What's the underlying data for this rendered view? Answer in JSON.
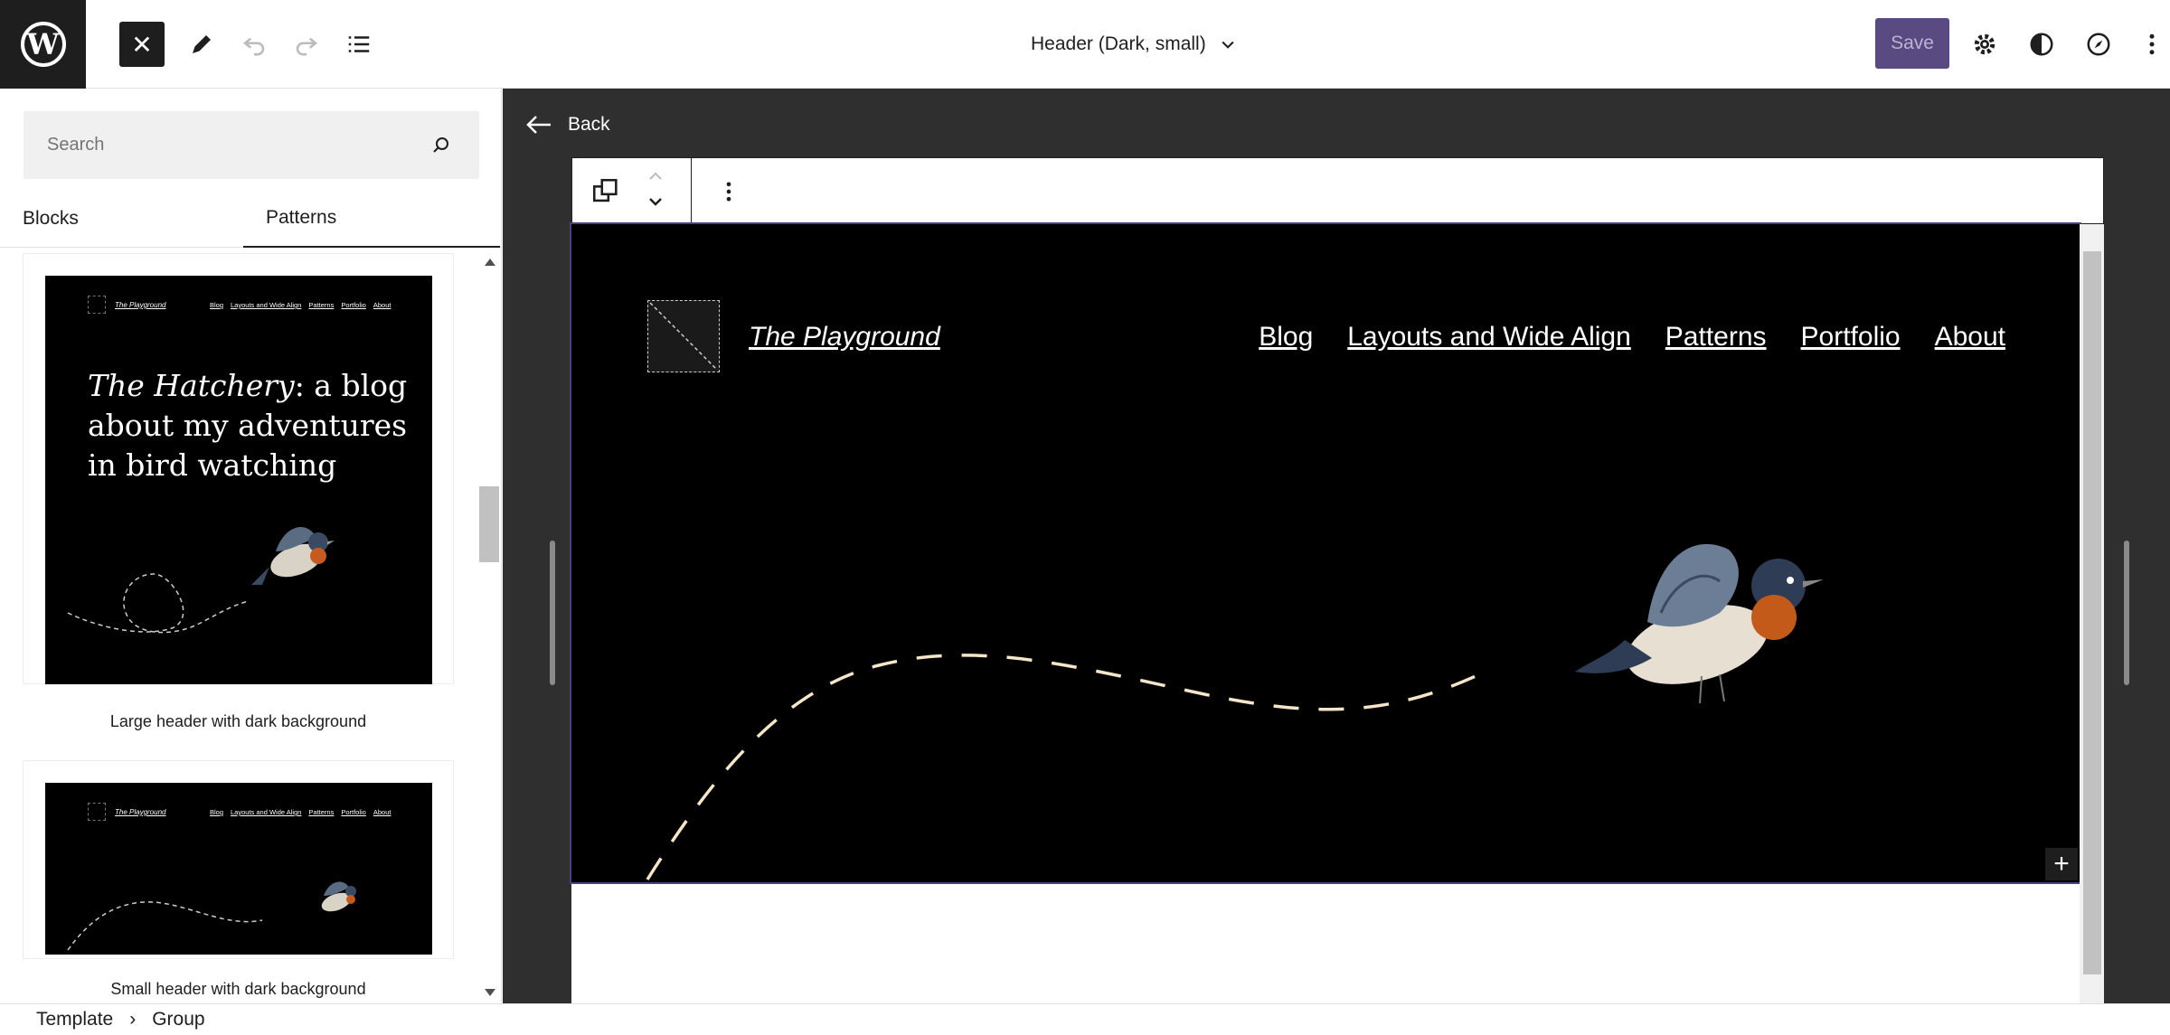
{
  "topbar": {
    "document_title": "Header (Dark, small)",
    "save_label": "Save"
  },
  "sidebar": {
    "search_placeholder": "Search",
    "tabs": [
      {
        "label": "Blocks",
        "active": false
      },
      {
        "label": "Patterns",
        "active": true
      }
    ],
    "patterns": [
      {
        "label": "Large header with dark background",
        "preview": {
          "site_title": "The Playground",
          "nav": [
            "Blog",
            "Layouts and Wide Align",
            "Patterns",
            "Portfolio",
            "About"
          ],
          "headline_italic": "The Hatchery",
          "headline_rest": ": a blog about my adventures in bird watching"
        }
      },
      {
        "label": "Small header with dark background",
        "preview": {
          "site_title": "The Playground",
          "nav": [
            "Blog",
            "Layouts and Wide Align",
            "Patterns",
            "Portfolio",
            "About"
          ]
        }
      }
    ]
  },
  "canvas": {
    "back_label": "Back",
    "header": {
      "site_title": "The Playground",
      "nav": [
        "Blog",
        "Layouts and Wide Align",
        "Patterns",
        "Portfolio",
        "About"
      ]
    }
  },
  "breadcrumb": [
    "Template",
    "Group"
  ],
  "colors": {
    "accent": "#4f3d86",
    "save_bg": "#5a4a82",
    "canvas_bg": "#2f2f2f",
    "dash_line": "#f5e6c8"
  }
}
